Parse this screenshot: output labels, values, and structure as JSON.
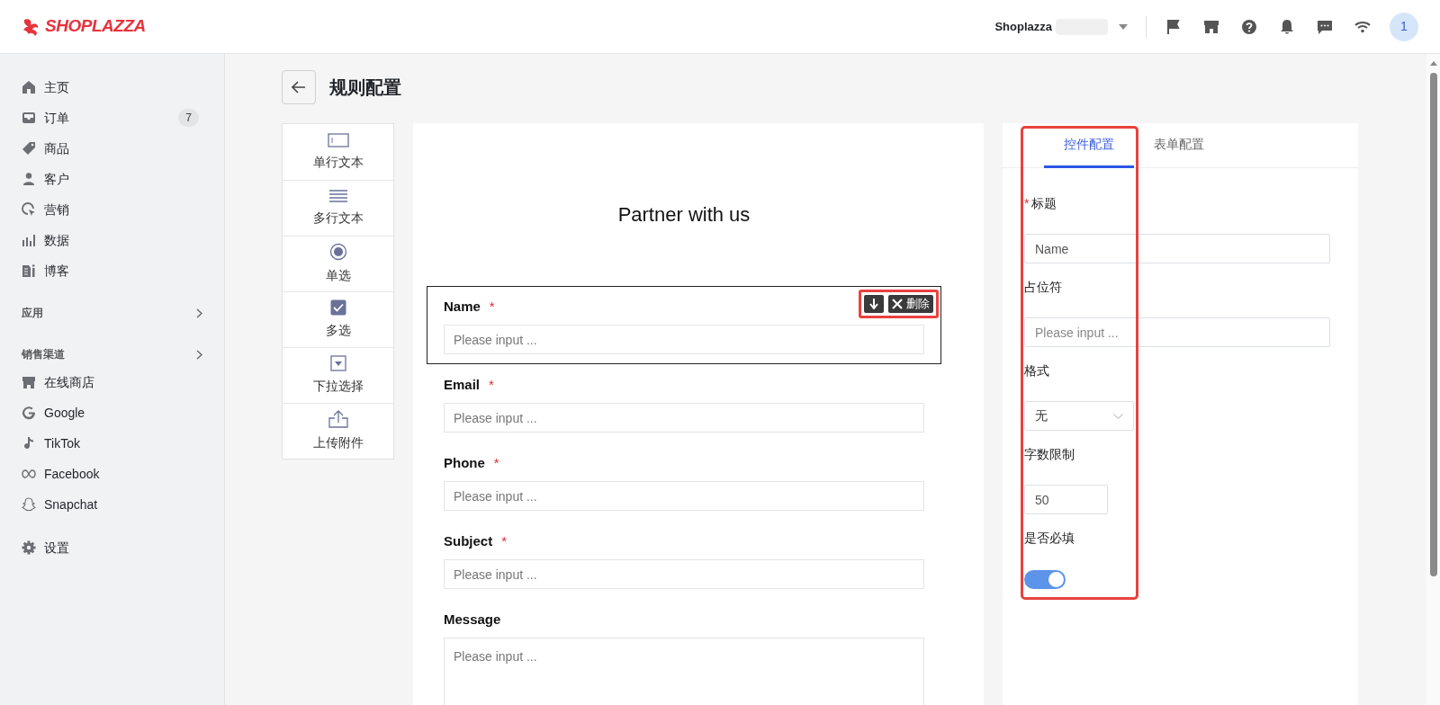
{
  "header": {
    "logo": "SHOPLAZZA",
    "store": "Shoplazza",
    "avatar": "1"
  },
  "sidebar": {
    "items": [
      {
        "label": "主页"
      },
      {
        "label": "订单",
        "badge": "7"
      },
      {
        "label": "商品"
      },
      {
        "label": "客户"
      },
      {
        "label": "营销"
      },
      {
        "label": "数据"
      },
      {
        "label": "博客"
      }
    ],
    "sections": [
      {
        "title": "应用"
      },
      {
        "title": "销售渠道",
        "items": [
          {
            "label": "在线商店"
          },
          {
            "label": "Google"
          },
          {
            "label": "TikTok"
          },
          {
            "label": "Facebook"
          },
          {
            "label": "Snapchat"
          }
        ]
      }
    ],
    "settings": "设置"
  },
  "page": {
    "title": "规则配置"
  },
  "palette": [
    {
      "label": "单行文本"
    },
    {
      "label": "多行文本"
    },
    {
      "label": "单选"
    },
    {
      "label": "多选"
    },
    {
      "label": "下拉选择"
    },
    {
      "label": "上传附件"
    }
  ],
  "form": {
    "title": "Partner with us",
    "toolbar": {
      "delete": "删除"
    },
    "fields": [
      {
        "label": "Name",
        "required_mark": "*",
        "placeholder": "Please input ...",
        "kind": "input",
        "selected": true
      },
      {
        "label": "Email",
        "required_mark": "*",
        "placeholder": "Please input ...",
        "kind": "input",
        "selected": false
      },
      {
        "label": "Phone",
        "required_mark": "*",
        "placeholder": "Please input ...",
        "kind": "input",
        "selected": false
      },
      {
        "label": "Subject",
        "required_mark": "*",
        "placeholder": "Please input ...",
        "kind": "input",
        "selected": false
      },
      {
        "label": "Message",
        "placeholder": "Please input ...",
        "kind": "textarea",
        "selected": false
      }
    ]
  },
  "settings_panel": {
    "tabs": [
      {
        "label": "控件配置",
        "selected": true
      },
      {
        "label": "表单配置",
        "selected": false
      }
    ],
    "title_label": "标题",
    "title_mark": "*",
    "title_value": "Name",
    "placeholder_label": "占位符",
    "placeholder_placeholder": "Please input ...",
    "format_label": "格式",
    "format_value": "无",
    "limit_label": "字数限制",
    "limit_value": "50",
    "required_label": "是否必填",
    "required_on": true
  }
}
